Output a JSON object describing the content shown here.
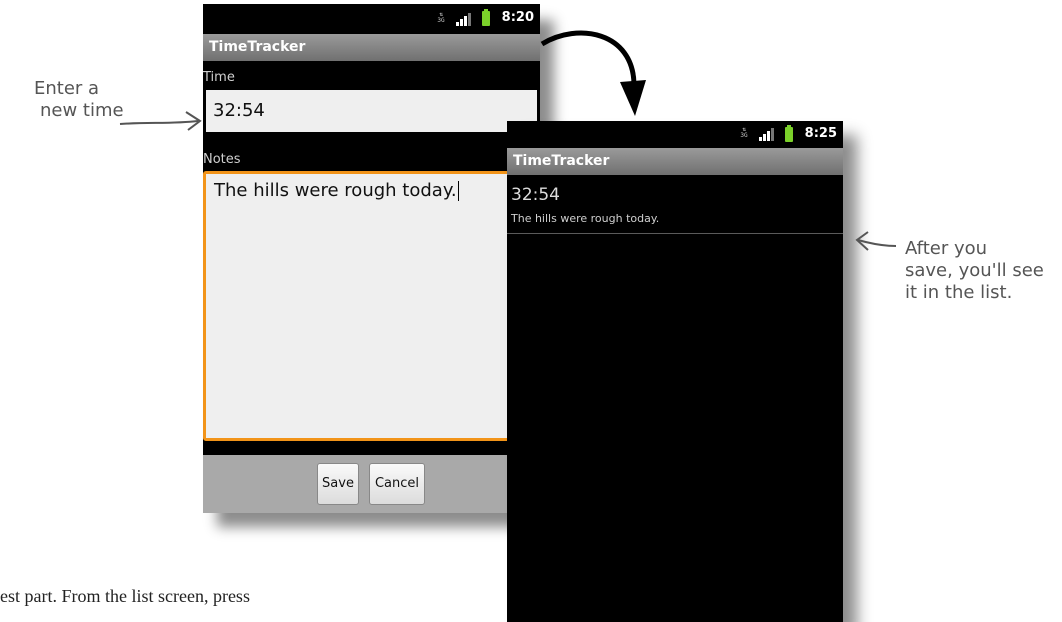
{
  "left_screen": {
    "status_time": "8:20",
    "app_title": "TimeTracker",
    "time_label": "Time",
    "time_value": "32:54",
    "notes_label": "Notes",
    "notes_value": "The hills were rough today.",
    "save_label": "Save",
    "cancel_label": "Cancel"
  },
  "right_screen": {
    "status_time": "8:25",
    "app_title": "TimeTracker",
    "list_items": [
      {
        "time": "32:54",
        "notes": "The hills were rough today."
      }
    ]
  },
  "annotations": {
    "enter_line1": "Enter a",
    "enter_line2": "new time",
    "after_line1": "After you",
    "after_line2": "save, you'll see",
    "after_line3": "it in the list."
  },
  "body_text": "est part. From the list screen, press",
  "colors": {
    "focus_border": "#f29419",
    "battery": "#7bd12a",
    "titlebar": "#8a8a8a"
  }
}
